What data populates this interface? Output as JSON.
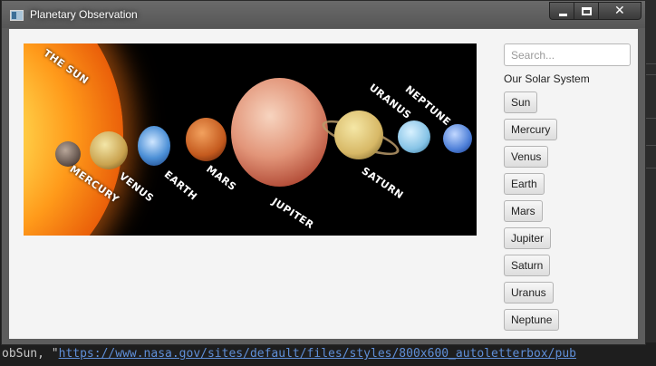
{
  "window": {
    "title": "Planetary Observation",
    "controls": {
      "minimize": "minimize-icon",
      "maximize": "maximize-icon",
      "close": "close-icon"
    }
  },
  "image": {
    "labels": {
      "sun": "THE SUN",
      "mercury": "MERCURY",
      "venus": "VENUS",
      "earth": "EARTH",
      "mars": "MARS",
      "jupiter": "JUPITER",
      "saturn": "SATURN",
      "uranus": "URANUS",
      "neptune": "NEPTUNE"
    }
  },
  "sidebar": {
    "search_placeholder": "Search...",
    "heading": "Our Solar System",
    "planets": [
      {
        "label": "Sun"
      },
      {
        "label": "Mercury"
      },
      {
        "label": "Venus"
      },
      {
        "label": "Earth"
      },
      {
        "label": "Mars"
      },
      {
        "label": "Jupiter"
      },
      {
        "label": "Saturn"
      },
      {
        "label": "Uranus"
      },
      {
        "label": "Neptune"
      }
    ]
  },
  "background": {
    "code_prefix": "obSun, \"",
    "code_link": "https://www.nasa.gov/sites/default/files/styles/800x600_autoletterbox/pub"
  },
  "colors": {
    "titlebar": "#5f5f5f",
    "client": "#f4f4f4",
    "link": "#5f8fd8"
  }
}
